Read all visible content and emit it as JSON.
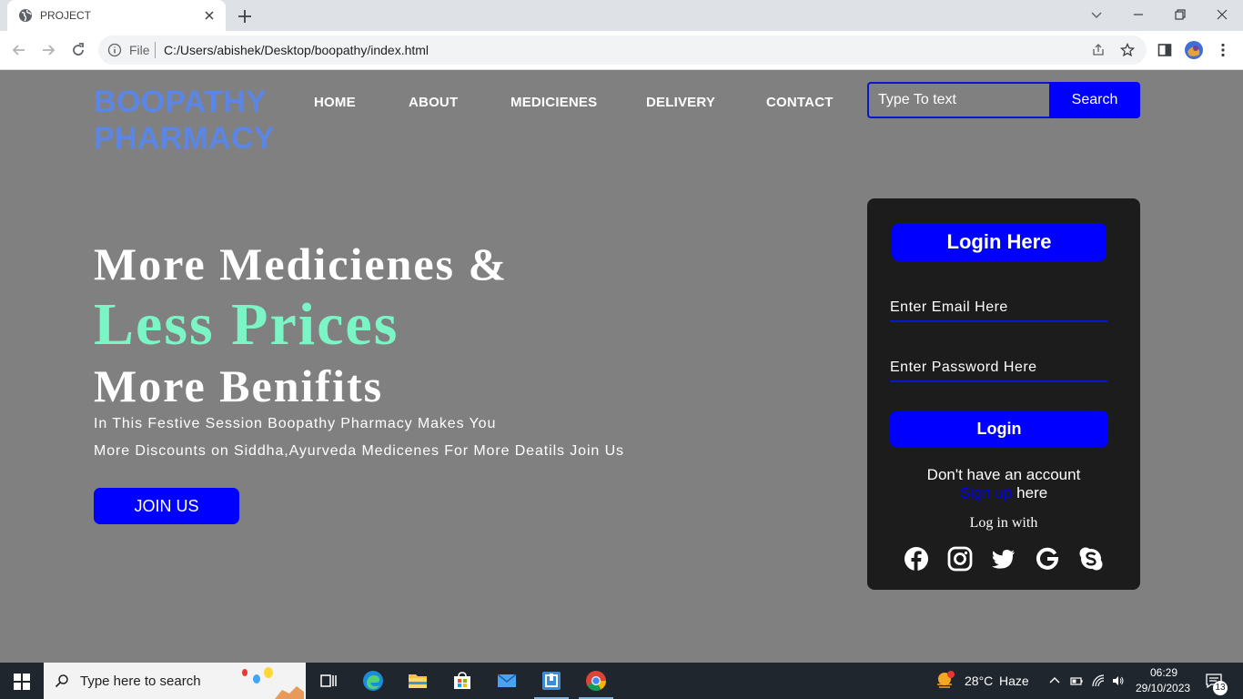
{
  "browser": {
    "tab_title": "PROJECT",
    "file_label": "File",
    "url": "C:/Users/abishek/Desktop/boopathy/index.html"
  },
  "site": {
    "logo_line1": "BOOPATHY",
    "logo_line2": "PHARMACY",
    "nav": [
      "HOME",
      "ABOUT",
      "MEDICIENES",
      "DELIVERY",
      "CONTACT"
    ],
    "search_placeholder": "Type To text",
    "search_button": "Search",
    "accent": "#0000ff",
    "logo_color": "#5b86e5",
    "highlight_color": "#7cf5c6"
  },
  "hero": {
    "line1": "More Medicienes &",
    "line2": "Less Prices",
    "line3": "More Benifits",
    "desc1": "In This Festive Session Boopathy Pharmacy Makes You",
    "desc2": "More Discounts on Siddha,Ayurveda Medicenes For More Deatils Join Us",
    "join_button": "JOIN US"
  },
  "login": {
    "title": "Login Here",
    "email_placeholder": "Enter Email Here",
    "password_placeholder": "Enter Password Here",
    "button": "Login",
    "no_account": "Don't have an account",
    "signup_link": "Sign up",
    "signup_suffix": " here",
    "login_with": "Log in with",
    "social_icons": [
      "facebook-icon",
      "instagram-icon",
      "twitter-icon",
      "google-icon",
      "skype-icon"
    ]
  },
  "taskbar": {
    "search_placeholder": "Type here to search",
    "weather_temp": "28°C",
    "weather_text": "Haze",
    "time": "06:29",
    "date": "29/10/2023",
    "notification_count": "13"
  }
}
